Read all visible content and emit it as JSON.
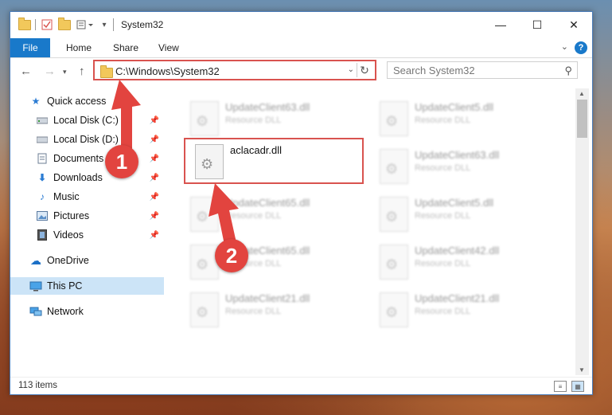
{
  "window": {
    "title": "System32",
    "controls": {
      "minimize": "—",
      "maximize": "☐",
      "close": "✕"
    }
  },
  "ribbon": {
    "file": "File",
    "tabs": [
      "Home",
      "Share",
      "View"
    ],
    "help": "?"
  },
  "nav": {
    "address": "C:\\Windows\\System32",
    "search_placeholder": "Search System32"
  },
  "sidebar": {
    "items": [
      {
        "label": "Quick access",
        "icon": "star-icon"
      },
      {
        "label": "Local Disk (C:)",
        "icon": "drive-icon",
        "pinned": true
      },
      {
        "label": "Local Disk (D:)",
        "icon": "drive-icon",
        "pinned": true
      },
      {
        "label": "Documents",
        "icon": "documents-icon",
        "pinned": true
      },
      {
        "label": "Downloads",
        "icon": "download-icon",
        "pinned": true
      },
      {
        "label": "Music",
        "icon": "music-icon",
        "pinned": true
      },
      {
        "label": "Pictures",
        "icon": "pictures-icon",
        "pinned": true
      },
      {
        "label": "Videos",
        "icon": "videos-icon",
        "pinned": true
      },
      {
        "label": "OneDrive",
        "icon": "cloud-icon"
      },
      {
        "label": "This PC",
        "icon": "computer-icon",
        "selected": true
      },
      {
        "label": "Network",
        "icon": "network-icon"
      }
    ]
  },
  "files": [
    {
      "name": "UpdateClient63.dll",
      "type": "Resource DLL"
    },
    {
      "name": "UpdateClient5.dll",
      "type": "Resource DLL"
    },
    {
      "name": "aclacadr.dll",
      "type": ""
    },
    {
      "name": "UpdateClient63.dll",
      "type": "Resource DLL"
    },
    {
      "name": "UpdateClient65.dll",
      "type": "Resource DLL"
    },
    {
      "name": "UpdateClient5.dll",
      "type": "Resource DLL"
    },
    {
      "name": "UpdateClient65.dll",
      "type": "Resource DLL"
    },
    {
      "name": "UpdateClient42.dll",
      "type": "Resource DLL"
    },
    {
      "name": "UpdateClient21.dll",
      "type": "Resource DLL"
    },
    {
      "name": "UpdateClient21.dll",
      "type": "Resource DLL"
    }
  ],
  "status": {
    "count": "113 items"
  },
  "annotations": {
    "step1": "1",
    "step2": "2",
    "color": "#e2443f"
  }
}
